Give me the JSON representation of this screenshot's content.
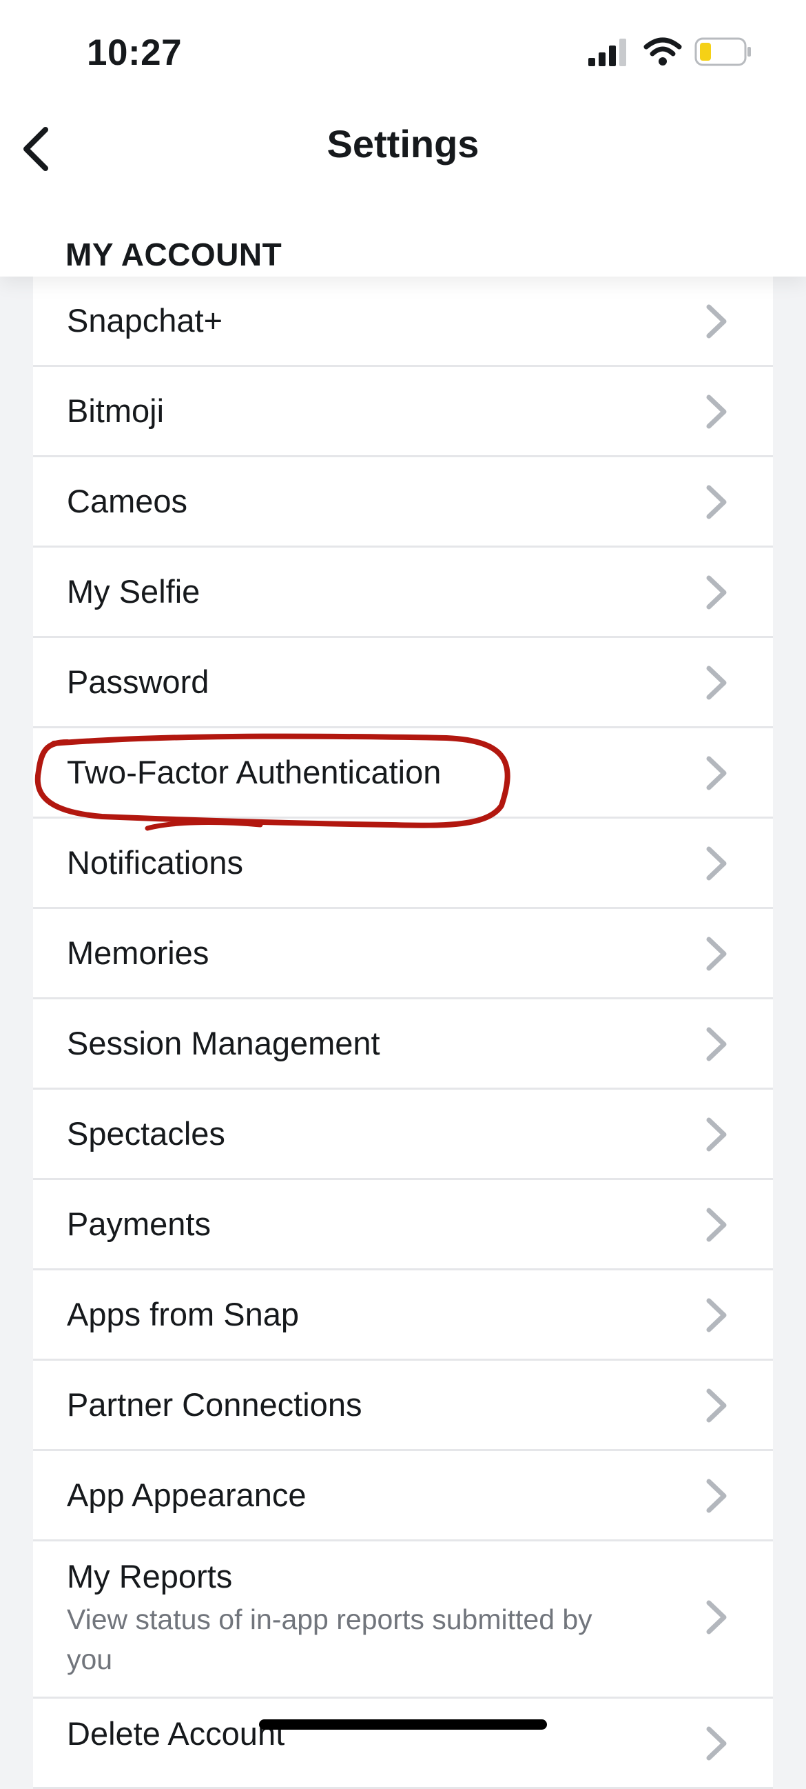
{
  "status_bar": {
    "time": "10:27",
    "icons": [
      "cellular-signal-icon",
      "wifi-icon",
      "battery-icon"
    ],
    "battery_color": "#f5d116"
  },
  "header": {
    "title": "Settings",
    "back_icon": "chevron-left-icon"
  },
  "section": {
    "title": "MY ACCOUNT"
  },
  "items": [
    {
      "label": "Snapchat+"
    },
    {
      "label": "Bitmoji"
    },
    {
      "label": "Cameos"
    },
    {
      "label": "My Selfie"
    },
    {
      "label": "Password"
    },
    {
      "label": "Two-Factor Authentication",
      "annotated": true
    },
    {
      "label": "Notifications"
    },
    {
      "label": "Memories"
    },
    {
      "label": "Session Management"
    },
    {
      "label": "Spectacles"
    },
    {
      "label": "Payments"
    },
    {
      "label": "Apps from Snap"
    },
    {
      "label": "Partner Connections"
    },
    {
      "label": "App Appearance"
    },
    {
      "label": "My Reports",
      "sublabel": "View status of in-app reports submitted by you"
    },
    {
      "label": "Delete Account"
    }
  ],
  "colors": {
    "annotation_stroke": "#b2170f",
    "chevron": "#b3b7bd",
    "background": "#f2f3f5"
  }
}
